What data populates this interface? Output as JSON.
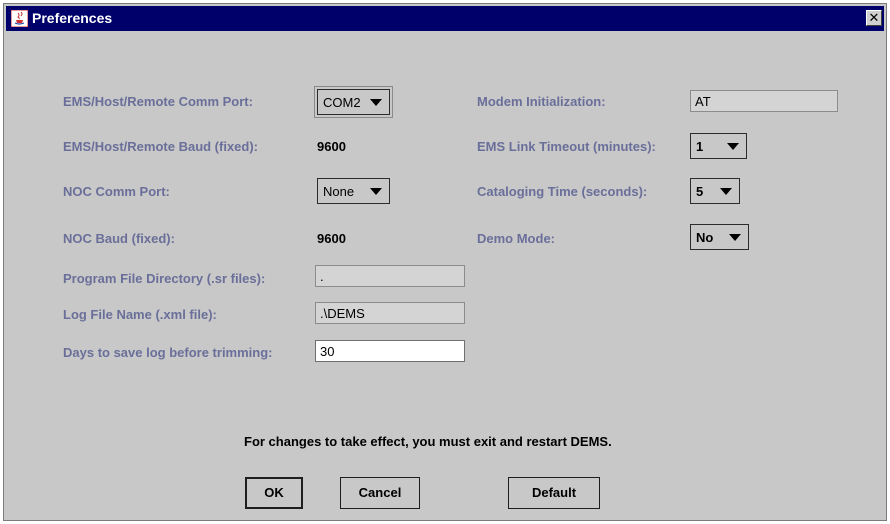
{
  "window": {
    "title": "Preferences",
    "close_glyph": "✕"
  },
  "left": {
    "comm_port_label": "EMS/Host/Remote Comm Port:",
    "comm_port_value": "COM2",
    "baud_label": "EMS/Host/Remote Baud (fixed):",
    "baud_value": "9600",
    "noc_port_label": "NOC Comm Port:",
    "noc_port_value": "None",
    "noc_baud_label": "NOC Baud (fixed):",
    "noc_baud_value": "9600",
    "program_dir_label": "Program File Directory (.sr files):",
    "program_dir_value": ".",
    "log_file_label": "Log File Name (.xml file):",
    "log_file_value": ".\\DEMS",
    "days_label": "Days to save log before trimming:",
    "days_value": "30"
  },
  "right": {
    "modem_label": "Modem Initialization:",
    "modem_value": "AT",
    "timeout_label": "EMS Link Timeout (minutes):",
    "timeout_value": "1",
    "catalog_label": "Cataloging Time (seconds):",
    "catalog_value": "5",
    "demo_label": "Demo Mode:",
    "demo_value": "No"
  },
  "note": "For changes to take effect, you must exit and restart DEMS.",
  "buttons": {
    "ok": "OK",
    "cancel": "Cancel",
    "default": "Default"
  },
  "colors": {
    "titlebar": "#00006b",
    "label": "#6a6f9a",
    "window_bg": "#c8c8c8"
  }
}
